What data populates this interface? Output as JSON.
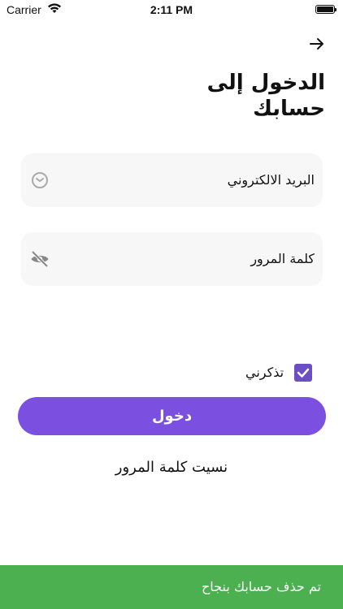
{
  "status_bar": {
    "carrier": "Carrier",
    "time": "2:11 PM",
    "icons": [
      "wifi-icon",
      "battery-icon"
    ]
  },
  "header": {
    "back_icon": "arrow-right-icon",
    "title": "الدخول إلى حسابك"
  },
  "form": {
    "email": {
      "placeholder": "البريد الالكتروني",
      "icon": "clock-icon",
      "value": ""
    },
    "password": {
      "placeholder": "كلمة المرور",
      "icon": "eye-off-icon",
      "value": ""
    },
    "remember_label": "تذكرني",
    "remember_checked": true
  },
  "actions": {
    "login_label": "دخول",
    "forgot_label": "نسيت كلمة المرور"
  },
  "toast": {
    "message": "تم حذف حسابك بنجاح"
  },
  "colors": {
    "primary": "#7b4fe0",
    "checkbox": "#6b4fc4",
    "field_bg": "#f7f7f7",
    "toast_bg": "#4caf50"
  }
}
